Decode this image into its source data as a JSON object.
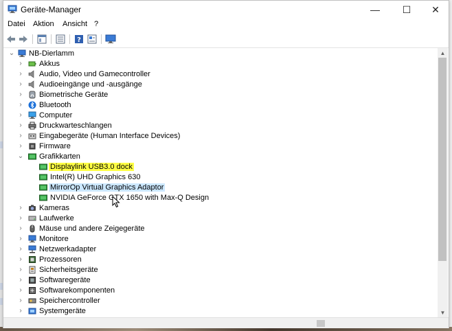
{
  "window": {
    "title": "Geräte-Manager",
    "controls": {
      "minimize": "—",
      "maximize": "☐",
      "close": "✕"
    }
  },
  "menu": [
    "Datei",
    "Aktion",
    "Ansicht",
    "?"
  ],
  "toolbar": {
    "icons": [
      "back-arrow-icon",
      "forward-arrow-icon",
      "properties-icon",
      "update-list-icon",
      "help-icon",
      "view-icon",
      "monitor-icon"
    ]
  },
  "tree": {
    "root": "NB-Dierlamm",
    "items": [
      {
        "label": "Akkus",
        "icon": "battery-icon",
        "expanded": false
      },
      {
        "label": "Audio, Video und Gamecontroller",
        "icon": "speaker-icon",
        "expanded": false
      },
      {
        "label": "Audioeingänge und -ausgänge",
        "icon": "speaker-icon",
        "expanded": false
      },
      {
        "label": "Biometrische Geräte",
        "icon": "fingerprint-icon",
        "expanded": false
      },
      {
        "label": "Bluetooth",
        "icon": "bluetooth-icon",
        "expanded": false
      },
      {
        "label": "Computer",
        "icon": "computer-icon",
        "expanded": false
      },
      {
        "label": "Druckwarteschlangen",
        "icon": "printer-icon",
        "expanded": false
      },
      {
        "label": "Eingabegeräte (Human Interface Devices)",
        "icon": "hid-icon",
        "expanded": false
      },
      {
        "label": "Firmware",
        "icon": "chip-icon",
        "expanded": false
      },
      {
        "label": "Grafikkarten",
        "icon": "display-adapter-icon",
        "expanded": true,
        "children": [
          {
            "label": "Displaylink USB3.0 dock",
            "icon": "display-adapter-icon",
            "state": "highlighted"
          },
          {
            "label": "Intel(R) UHD Graphics 630",
            "icon": "display-adapter-icon",
            "state": "normal"
          },
          {
            "label": "MirrorOp Virtual Graphics Adaptor",
            "icon": "display-adapter-icon",
            "state": "selected"
          },
          {
            "label": "NVIDIA GeForce GTX 1650 with Max-Q Design",
            "icon": "display-adapter-icon",
            "state": "normal"
          }
        ]
      },
      {
        "label": "Kameras",
        "icon": "camera-icon",
        "expanded": false
      },
      {
        "label": "Laufwerke",
        "icon": "drive-icon",
        "expanded": false
      },
      {
        "label": "Mäuse und andere Zeigegeräte",
        "icon": "mouse-icon",
        "expanded": false
      },
      {
        "label": "Monitore",
        "icon": "monitor-icon",
        "expanded": false
      },
      {
        "label": "Netzwerkadapter",
        "icon": "network-icon",
        "expanded": false
      },
      {
        "label": "Prozessoren",
        "icon": "processor-icon",
        "expanded": false
      },
      {
        "label": "Sicherheitsgeräte",
        "icon": "security-icon",
        "expanded": false
      },
      {
        "label": "Softwaregeräte",
        "icon": "software-device-icon",
        "expanded": false
      },
      {
        "label": "Softwarekomponenten",
        "icon": "software-component-icon",
        "expanded": false
      },
      {
        "label": "Speichercontroller",
        "icon": "storage-controller-icon",
        "expanded": false
      },
      {
        "label": "Systemgeräte",
        "icon": "system-device-icon",
        "expanded": false
      }
    ]
  },
  "colors": {
    "highlight": "#ffff44",
    "selection": "#cce8ff"
  }
}
